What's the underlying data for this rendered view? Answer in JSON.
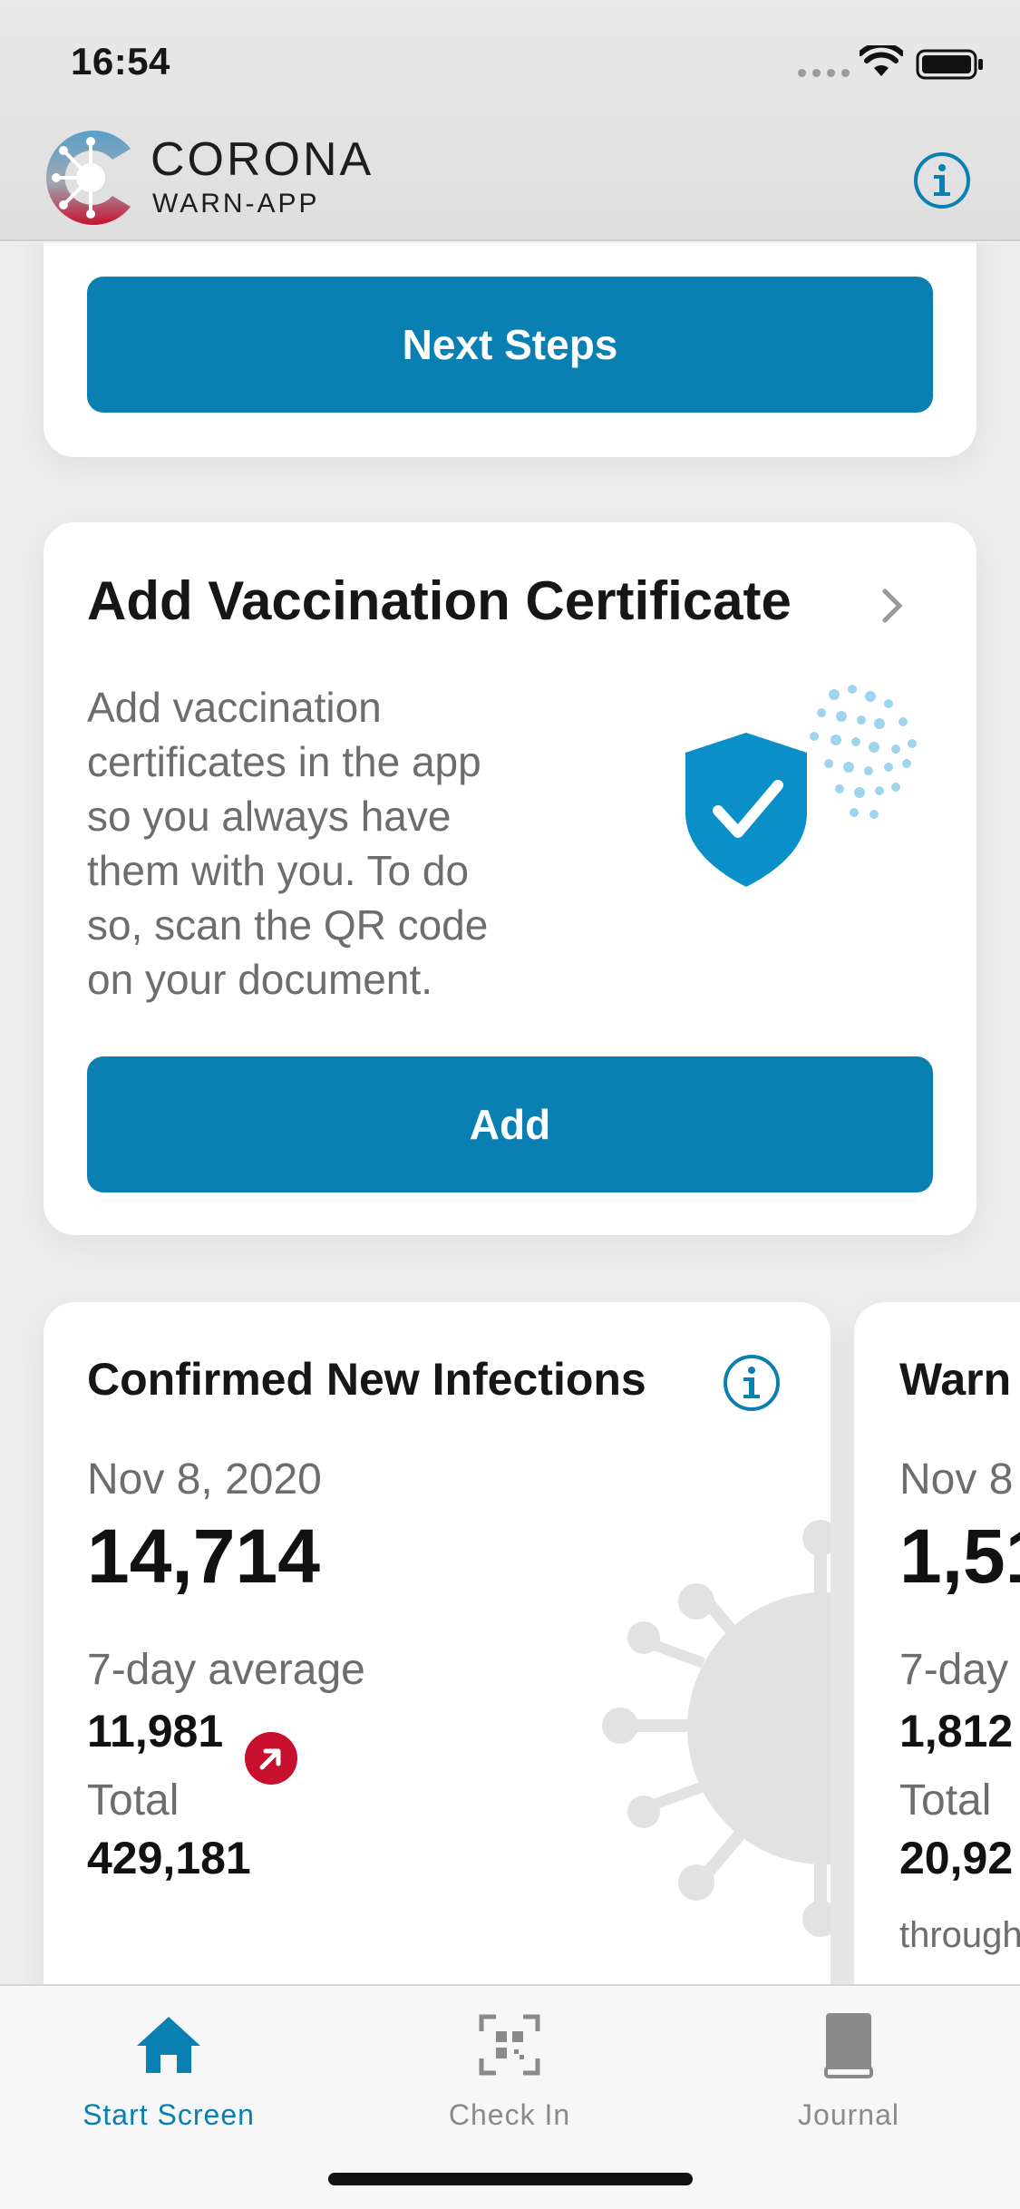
{
  "status_bar": {
    "time": "16:54"
  },
  "header": {
    "brand_line1": "CORONA",
    "brand_line2": "WARN-APP"
  },
  "next_steps_card": {
    "button_label": "Next Steps"
  },
  "vaccination_card": {
    "title": "Add Vaccination Certificate",
    "description_lines": [
      "Add vaccination",
      "certificates in the app",
      "so you always have",
      "them with you. To do",
      "so, scan the QR code",
      "on your document."
    ],
    "button_label": "Add"
  },
  "stats": [
    {
      "title": "Confirmed New Infections",
      "date": "Nov 8, 2020",
      "value": "14,714",
      "avg_label": "7-day average",
      "avg_value": "11,981",
      "trend": "up",
      "total_label": "Total",
      "total_value": "429,181"
    },
    {
      "title": "Warn",
      "date": "Nov 8",
      "value": "1,51",
      "avg_label": "7-day",
      "avg_value": "1,812",
      "total_label": "Total",
      "total_value": "20,92",
      "footer": "through"
    }
  ],
  "tabbar": {
    "tabs": [
      {
        "label": "Start Screen",
        "icon": "home-icon",
        "active": true
      },
      {
        "label": "Check In",
        "icon": "qr-code-icon",
        "active": false
      },
      {
        "label": "Journal",
        "icon": "book-icon",
        "active": false
      }
    ]
  },
  "colors": {
    "accent": "#0a7fb1",
    "trend_up": "#c8102e",
    "inactive_tab": "#8a8a8a"
  }
}
